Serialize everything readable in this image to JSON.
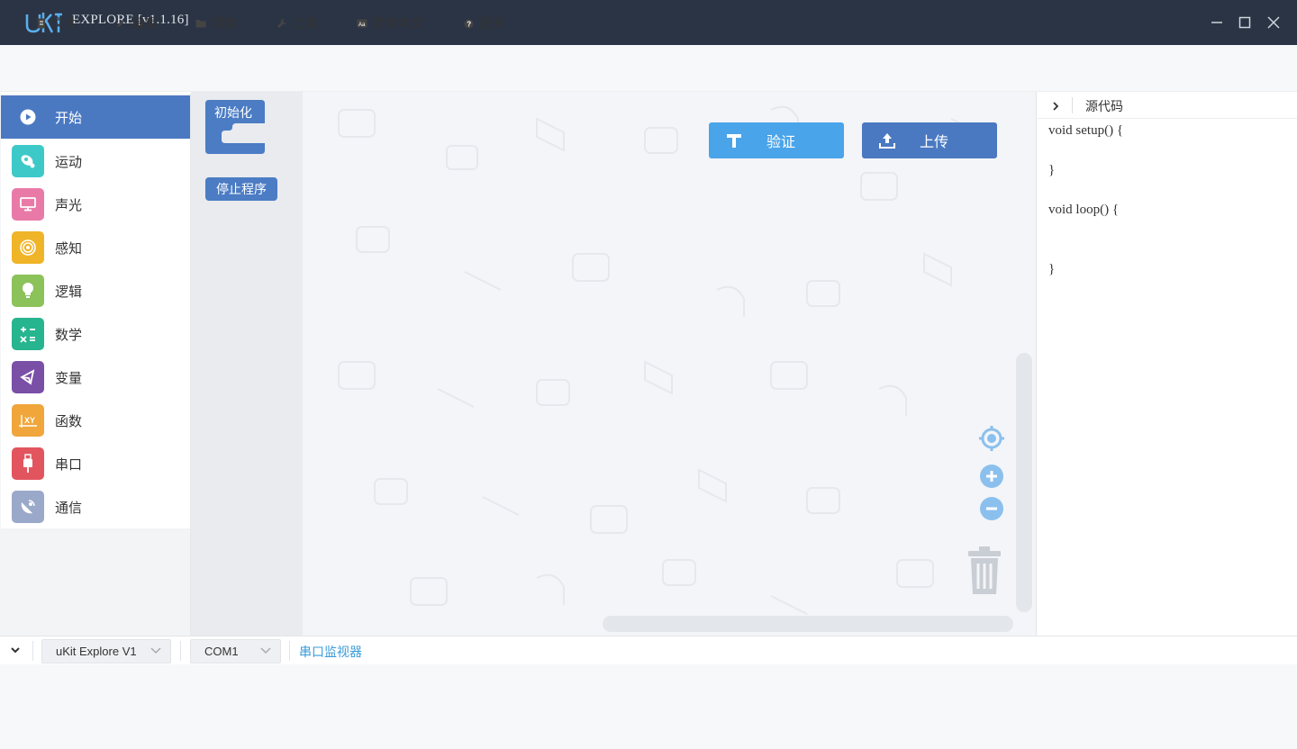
{
  "window": {
    "logo_text": "uKit",
    "title": "EXPLORE [v1.1.16]"
  },
  "menu": {
    "items": [
      {
        "label": "文件",
        "icon": "file-icon"
      },
      {
        "label": "编辑",
        "icon": "edit-icon"
      },
      {
        "label": "项目",
        "icon": "folder-icon"
      },
      {
        "label": "工具",
        "icon": "wrench-icon"
      },
      {
        "label": "简体中文",
        "icon": "language-icon"
      },
      {
        "label": "更多",
        "icon": "help-icon"
      }
    ]
  },
  "categories": [
    {
      "label": "开始",
      "color": "#4a79c2",
      "icon": "play-icon",
      "active": true
    },
    {
      "label": "运动",
      "color": "#3ec9c9",
      "icon": "motion-icon"
    },
    {
      "label": "声光",
      "color": "#e97aa8",
      "icon": "monitor-icon"
    },
    {
      "label": "感知",
      "color": "#f0b428",
      "icon": "sensor-icon"
    },
    {
      "label": "逻辑",
      "color": "#8cc25a",
      "icon": "bulb-icon"
    },
    {
      "label": "数学",
      "color": "#27b58f",
      "icon": "math-icon"
    },
    {
      "label": "变量",
      "color": "#7a4fa6",
      "icon": "variable-icon"
    },
    {
      "label": "函数",
      "color": "#f0a63a",
      "icon": "function-icon"
    },
    {
      "label": "串口",
      "color": "#e2555f",
      "icon": "usb-icon"
    },
    {
      "label": "通信",
      "color": "#9aa9c9",
      "icon": "satellite-icon"
    }
  ],
  "blocks": {
    "init": "初始化",
    "stop": "停止程序"
  },
  "toolbar": {
    "verify": "验证",
    "upload": "上传"
  },
  "code_panel": {
    "title": "源代码",
    "lines": [
      "void setup() {",
      "",
      "}",
      "",
      "void loop() {",
      "",
      "",
      "}"
    ]
  },
  "status": {
    "board": "uKit Explore V1",
    "port": "COM1",
    "serial_monitor": "串口监视器"
  },
  "colors": {
    "titlebar": "#2b3444",
    "accent": "#4a79c2",
    "verify": "#4aa4ea",
    "link": "#3a9bd9"
  }
}
